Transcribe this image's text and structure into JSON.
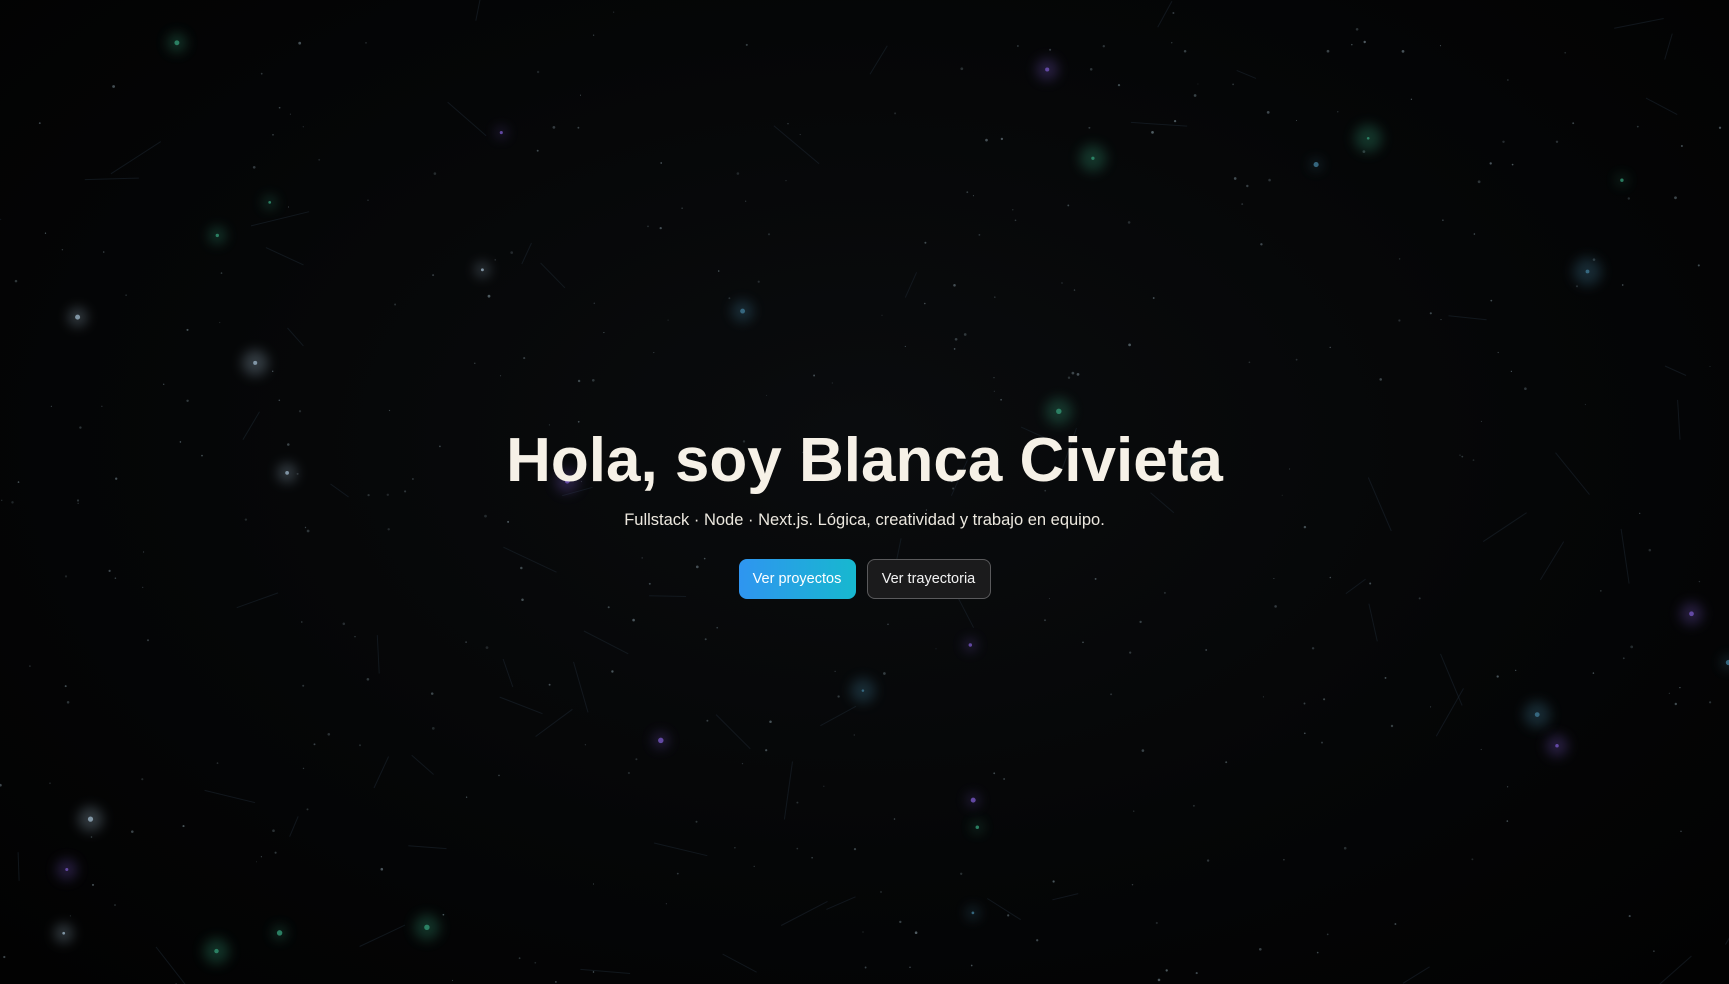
{
  "hero": {
    "title": "Hola, soy Blanca Civieta",
    "subtitle": "Fullstack · Node · Next.js. Lógica, creatividad y trabajo en equipo."
  },
  "actions": {
    "primary_label": "Ver proyectos",
    "secondary_label": "Ver trayectoria"
  },
  "background": {
    "type": "starfield",
    "star_colors": [
      "#3a6f88",
      "#2f8a6a",
      "#6a4fb0",
      "#8aa0b0"
    ],
    "base_color": "#050505"
  },
  "colors": {
    "title": "#f6f1e7",
    "primary_start": "#2f95f0",
    "primary_end": "#17b8cf",
    "secondary_bg": "#1b1b1c"
  }
}
